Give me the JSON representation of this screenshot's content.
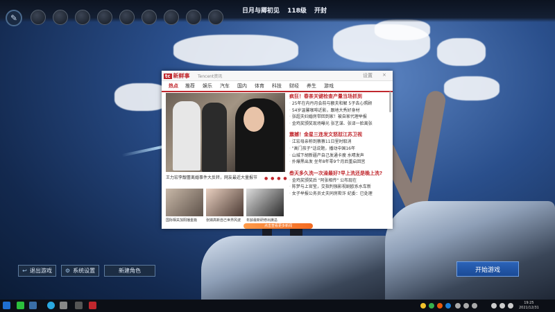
{
  "hud": {
    "server_name": "日月与卿初见",
    "ping": "118级",
    "status": "开封",
    "slot_count": 9
  },
  "popup": {
    "brand": "新鲜事",
    "brand_logo": "tc",
    "brand_sub": "Tencent资讯",
    "controls": [
      "设置",
      "×"
    ],
    "nav": [
      "热点",
      "推荐",
      "娱乐",
      "汽车",
      "国内",
      "体育",
      "科技",
      "财经",
      "养生",
      "游戏"
    ],
    "main_caption": "王力宏李靓蕾离婚事件大反转，网友最近大量报节",
    "thumbs": [
      {
        "caption": "国际相关加阳播金篇"
      },
      {
        "caption": "张婧高新自己世界风波"
      },
      {
        "caption": "年龄最新研修出席总"
      }
    ],
    "news": [
      {
        "type": "headline",
        "text": "疯狂！春茶关键检查产量当场抓到"
      },
      {
        "type": "item",
        "text": "25年在内丹月会前与额夫和解 5子去心照顾"
      },
      {
        "type": "item",
        "text": "54岁温馨咖啡近影，跟地大秀好身材"
      },
      {
        "type": "item",
        "text": "张超夫妇婚房带回到家！被自家代理举报"
      },
      {
        "type": "item",
        "text": "金鸡奖颁奖现场曝光 张艺谋、张译一脸离张"
      },
      {
        "type": "headline",
        "text": "震撼！金星三连发文怒怼江苏卫视"
      },
      {
        "type": "item",
        "text": "江宏母亲称到蔡蔡11日里时取消"
      },
      {
        "type": "item",
        "text": "\"高门孩子\"话说题，播动中国16年"
      },
      {
        "type": "item",
        "text": "山城下胡新疆产自己发通卡瘦 水晴发声"
      },
      {
        "type": "item",
        "text": "扑爆黑出发 坐年8年零9个月后重启回宫"
      },
      {
        "type": "headline",
        "text": "叁天多久洗一次澡最好?早上洗还是晚上洗?"
      },
      {
        "type": "item",
        "text": "金鸡奖颁奖后 \"阿张相传\" 公布现在"
      },
      {
        "type": "item",
        "text": "陈梦与上官莹，交指判强影视剧欧系水车新"
      },
      {
        "type": "item",
        "text": "女子举报公务员丈夫同房欺诈 纪委：已处理"
      }
    ],
    "footer_label": "点击查看更多新闻"
  },
  "buttons": {
    "exit": "退出游戏",
    "settings": "系统设置",
    "create_role": "新建角色",
    "start": "开始游戏"
  },
  "taskbar": {
    "time": "19:25",
    "date": "2021/12/31"
  },
  "icons": {
    "settings": "gear-icon",
    "exit": "exit-icon",
    "system": "system-icon",
    "windows": "windows-start-icon"
  }
}
